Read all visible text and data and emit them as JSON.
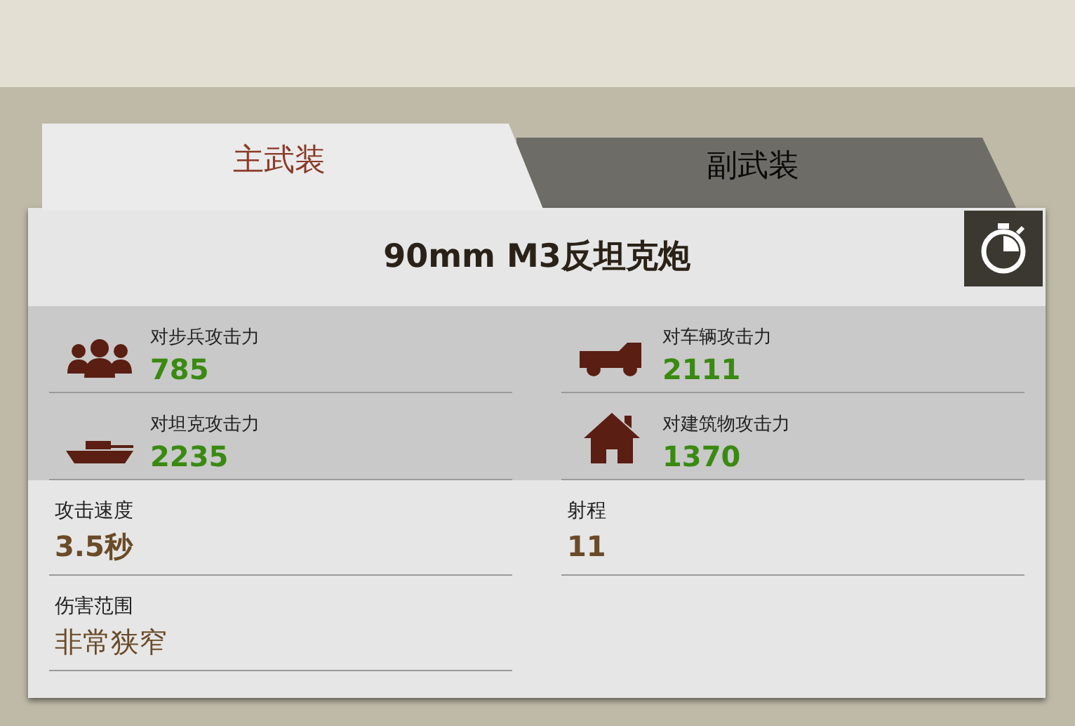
{
  "tabs": [
    {
      "label": "主武装",
      "selected": true
    },
    {
      "label": "副武装",
      "selected": false
    }
  ],
  "weapon_name": "90mm M3反坦克炮",
  "attack_stats": [
    {
      "kind": "infantry",
      "label": "对步兵攻击力",
      "value": "785"
    },
    {
      "kind": "vehicle",
      "label": "对车辆攻击力",
      "value": "2111"
    },
    {
      "kind": "tank",
      "label": "对坦克攻击力",
      "value": "2235"
    },
    {
      "kind": "building",
      "label": "对建筑物攻击力",
      "value": "1370"
    }
  ],
  "other_stats": [
    {
      "kind": "number",
      "label": "攻击速度",
      "value": "3.5秒"
    },
    {
      "kind": "number",
      "label": "射程",
      "value": "11"
    },
    {
      "kind": "text",
      "label": "伤害范围",
      "value": "非常狭窄"
    }
  ]
}
